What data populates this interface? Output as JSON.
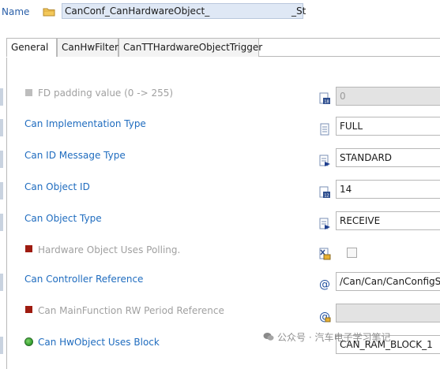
{
  "header": {
    "name_label": "Name",
    "name_value_left": "CanConf_CanHardwareObject_",
    "name_value_right": "_St",
    "folder_icon": "folder-icon"
  },
  "tabs": [
    {
      "label": "General",
      "active": true
    },
    {
      "label": "CanHwFilter",
      "active": false
    },
    {
      "label": "CanTTHardwareObjectTrigger",
      "active": false
    }
  ],
  "rows": [
    {
      "label": "FD padding value (0 -> 255)",
      "status": "disabled",
      "value": "0",
      "icon": "numeric-param-icon"
    },
    {
      "label": "Can Implementation Type",
      "status": "enabled",
      "value": "FULL",
      "icon": "document-param-icon"
    },
    {
      "label": "Can ID Message Type",
      "status": "enabled",
      "value": "STANDARD",
      "icon": "enum-param-icon"
    },
    {
      "label": "Can Object ID",
      "status": "enabled",
      "value": "14",
      "icon": "numeric-param-icon"
    },
    {
      "label": "Can Object Type",
      "status": "enabled",
      "value": "RECEIVE",
      "icon": "enum-param-icon"
    },
    {
      "label": "Hardware Object Uses Polling.",
      "status": "disabled",
      "value": "",
      "icon": "boolean-param-icon"
    },
    {
      "label": "Can Controller Reference",
      "status": "enabled",
      "value": "/Can/Can/CanConfigS",
      "icon": "reference-param-icon"
    },
    {
      "label": "Can MainFunction RW Period Reference",
      "status": "disabled",
      "value": "",
      "icon": "reference-param-icon"
    },
    {
      "label": "Can HwObject Uses Block",
      "status": "enabled",
      "value": "CAN_RAM_BLOCK_1",
      "icon": "enum-param-icon"
    }
  ],
  "watermark": "公众号 · 汽车电子学习笔记",
  "colors": {
    "link": "#1f6cbf",
    "disabled_text": "#a0a0a0",
    "name_field_bg": "#dfe8f5"
  }
}
